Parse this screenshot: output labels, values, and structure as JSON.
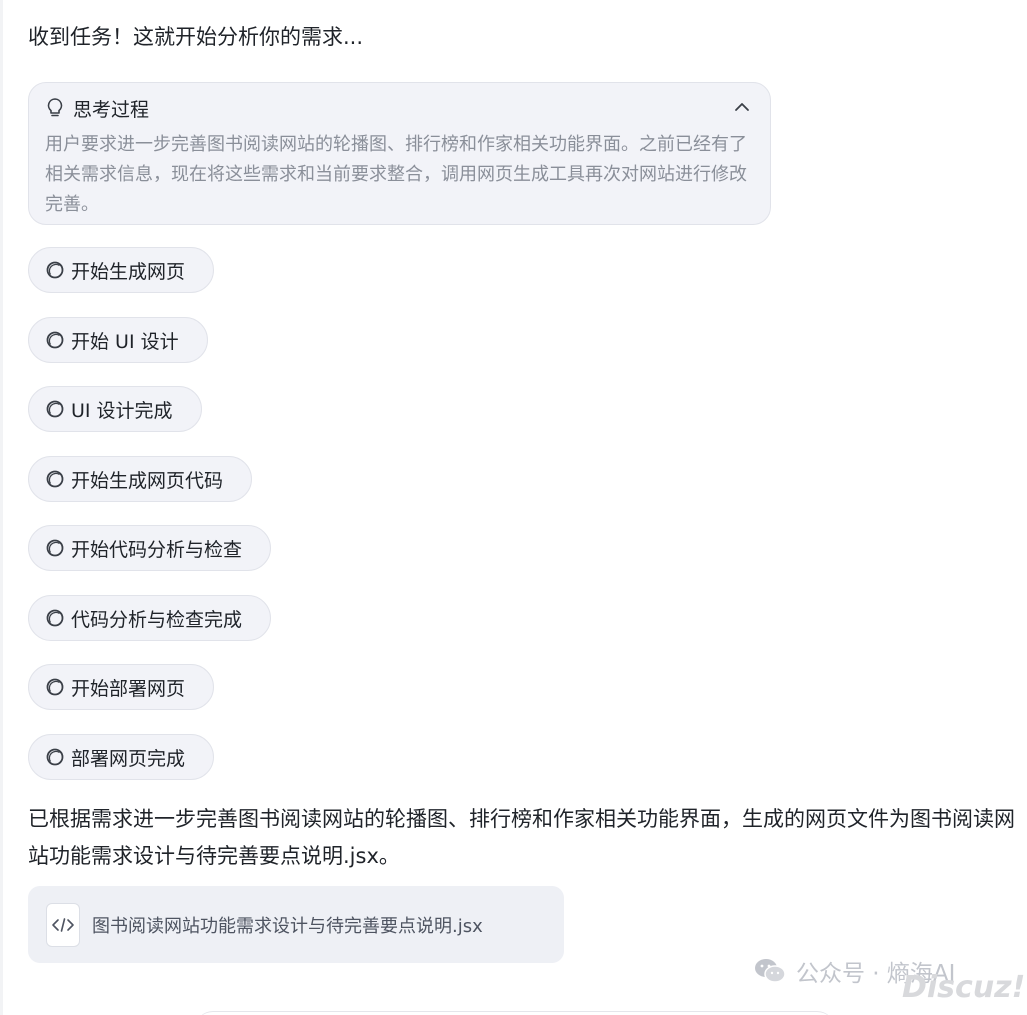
{
  "intro_text": "收到任务！这就开始分析你的需求...",
  "thinking": {
    "title": "思考过程",
    "body": "用户要求进一步完善图书阅读网站的轮播图、排行榜和作家相关功能界面。之前已经有了相关需求信息，现在将这些需求和当前要求整合，调用网页生成工具再次对网站进行修改完善。",
    "icon": "lightbulb-icon",
    "toggle_icon": "chevron-up-icon"
  },
  "steps": [
    {
      "label": "开始生成网页"
    },
    {
      "label": "开始 UI 设计"
    },
    {
      "label": "UI 设计完成"
    },
    {
      "label": "开始生成网页代码"
    },
    {
      "label": "开始代码分析与检查"
    },
    {
      "label": "代码分析与检查完成"
    },
    {
      "label": "开始部署网页"
    },
    {
      "label": "部署网页完成"
    }
  ],
  "result_text": "已根据需求进一步完善图书阅读网站的轮播图、排行榜和作家相关功能界面，生成的网页文件为图书阅读网站功能需求设计与待完善要点说明.jsx。",
  "file": {
    "name": "图书阅读网站功能需求设计与待完善要点说明.jsx",
    "icon": "code-file-icon"
  },
  "watermark": {
    "text": "公众号 · 熵海AI",
    "site": "Discuz!"
  }
}
